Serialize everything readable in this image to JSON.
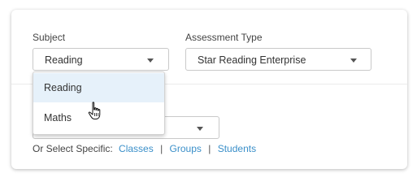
{
  "filters": {
    "subject": {
      "label": "Subject",
      "selected": "Reading",
      "options": [
        "Reading",
        "Maths"
      ],
      "highlighted_option": "Reading"
    },
    "assessment_type": {
      "label": "Assessment Type",
      "selected": "Star Reading Enterprise"
    },
    "third_select": {
      "selected": ""
    },
    "select_specific": {
      "prefix": "Or Select Specific:",
      "links": [
        "Classes",
        "Groups",
        "Students"
      ],
      "separator": "|"
    }
  },
  "colors": {
    "link": "#3a8fc9",
    "option_hover": "#e6f1fa",
    "border": "#c9c9c9"
  },
  "icons": {
    "select_caret": "chevron-down-icon",
    "cursor": "hand-pointer-icon"
  }
}
